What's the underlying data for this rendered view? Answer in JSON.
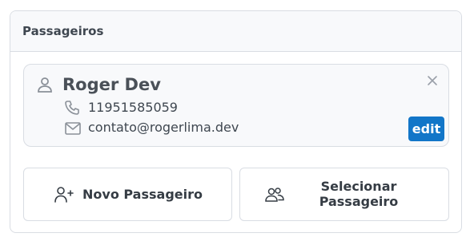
{
  "panel": {
    "title": "Passageiros"
  },
  "passenger": {
    "name": "Roger Dev",
    "phone": "11951585059",
    "email": "contato@rogerlima.dev",
    "edit_label": "edit",
    "icons": {
      "person": "person-icon",
      "phone": "phone-icon",
      "email": "mail-icon",
      "close": "close-icon"
    }
  },
  "actions": {
    "new_label": "Novo Passageiro",
    "new_icon": "user-plus-icon",
    "select_label": "Selecionar Passageiro",
    "select_icon": "users-icon"
  },
  "colors": {
    "accent": "#1276c8",
    "border": "#d9dde3",
    "header_bg": "#f8f9fb",
    "text": "#3f4750"
  }
}
